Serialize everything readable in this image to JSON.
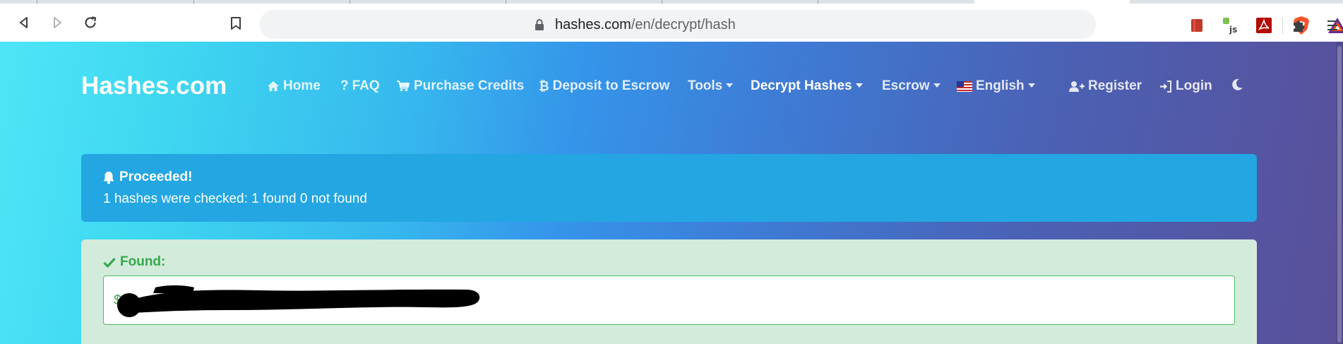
{
  "browser": {
    "url_host": "hashes.com",
    "url_path": "/en/decrypt/hash",
    "icons": [
      "back-icon",
      "forward-icon",
      "reload-icon",
      "bookmark-icon",
      "lock-icon",
      "brave-shields-icon",
      "brave-rewards-icon",
      "extension-book-icon",
      "extension-js-icon",
      "extension-pdf-icon",
      "extensions-puzzle-icon",
      "menu-icon"
    ]
  },
  "site": {
    "brand": "Hashes.com",
    "nav": {
      "home": "Home",
      "faq": "FAQ",
      "purchase": "Purchase Credits",
      "deposit": "Deposit to Escrow",
      "tools": "Tools",
      "decrypt": "Decrypt Hashes",
      "escrow": "Escrow",
      "language": "English",
      "register": "Register",
      "login": "Login"
    }
  },
  "alert_info": {
    "title": "Proceeded!",
    "message": "1 hashes were checked: 1 found 0 not found"
  },
  "alert_found": {
    "title": "Found:",
    "prefix": "$"
  },
  "colors": {
    "info": "#23a6e2",
    "success_bg": "#d3ebdb",
    "success_text": "#37a84f"
  }
}
